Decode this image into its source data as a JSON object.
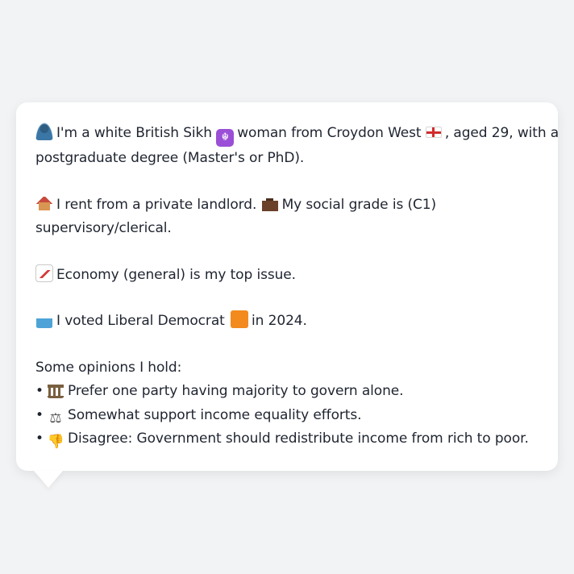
{
  "persona": {
    "intro_line1": "I'm a white British Sikh",
    "intro_line1b": "woman from Croydon West",
    "intro_line1c": ", aged 29, with a",
    "intro_line2": "postgraduate degree (Master's or PhD).",
    "housing_line1a": "I rent from a private landlord.",
    "housing_line1b": "My social grade is (C1)",
    "housing_line2": "supervisory/clerical.",
    "issue": "Economy (general) is my top issue.",
    "vote_a": "I voted Liberal Democrat",
    "vote_b": "in 2024.",
    "opinions_heading": "Some opinions I hold:",
    "opinions": [
      "Prefer one party having majority to govern alone.",
      "Somewhat support income equality efforts.",
      "Disagree: Government should redistribute income from rich to poor."
    ]
  },
  "icons": {
    "person": "person-icon",
    "religion": "khanda-icon",
    "flag": "england-flag-icon",
    "house": "house-icon",
    "briefcase": "briefcase-icon",
    "issue": "chart-icon",
    "ballot": "ballot-box-icon",
    "party_color": "orange-square-icon",
    "opinion_icons": [
      "classical-building-icon",
      "balance-scale-icon",
      "thumbs-down-icon"
    ]
  },
  "colors": {
    "background": "#f1f3f5",
    "bubble": "#ffffff",
    "text": "#1f2430",
    "party": "#f28a1e"
  }
}
